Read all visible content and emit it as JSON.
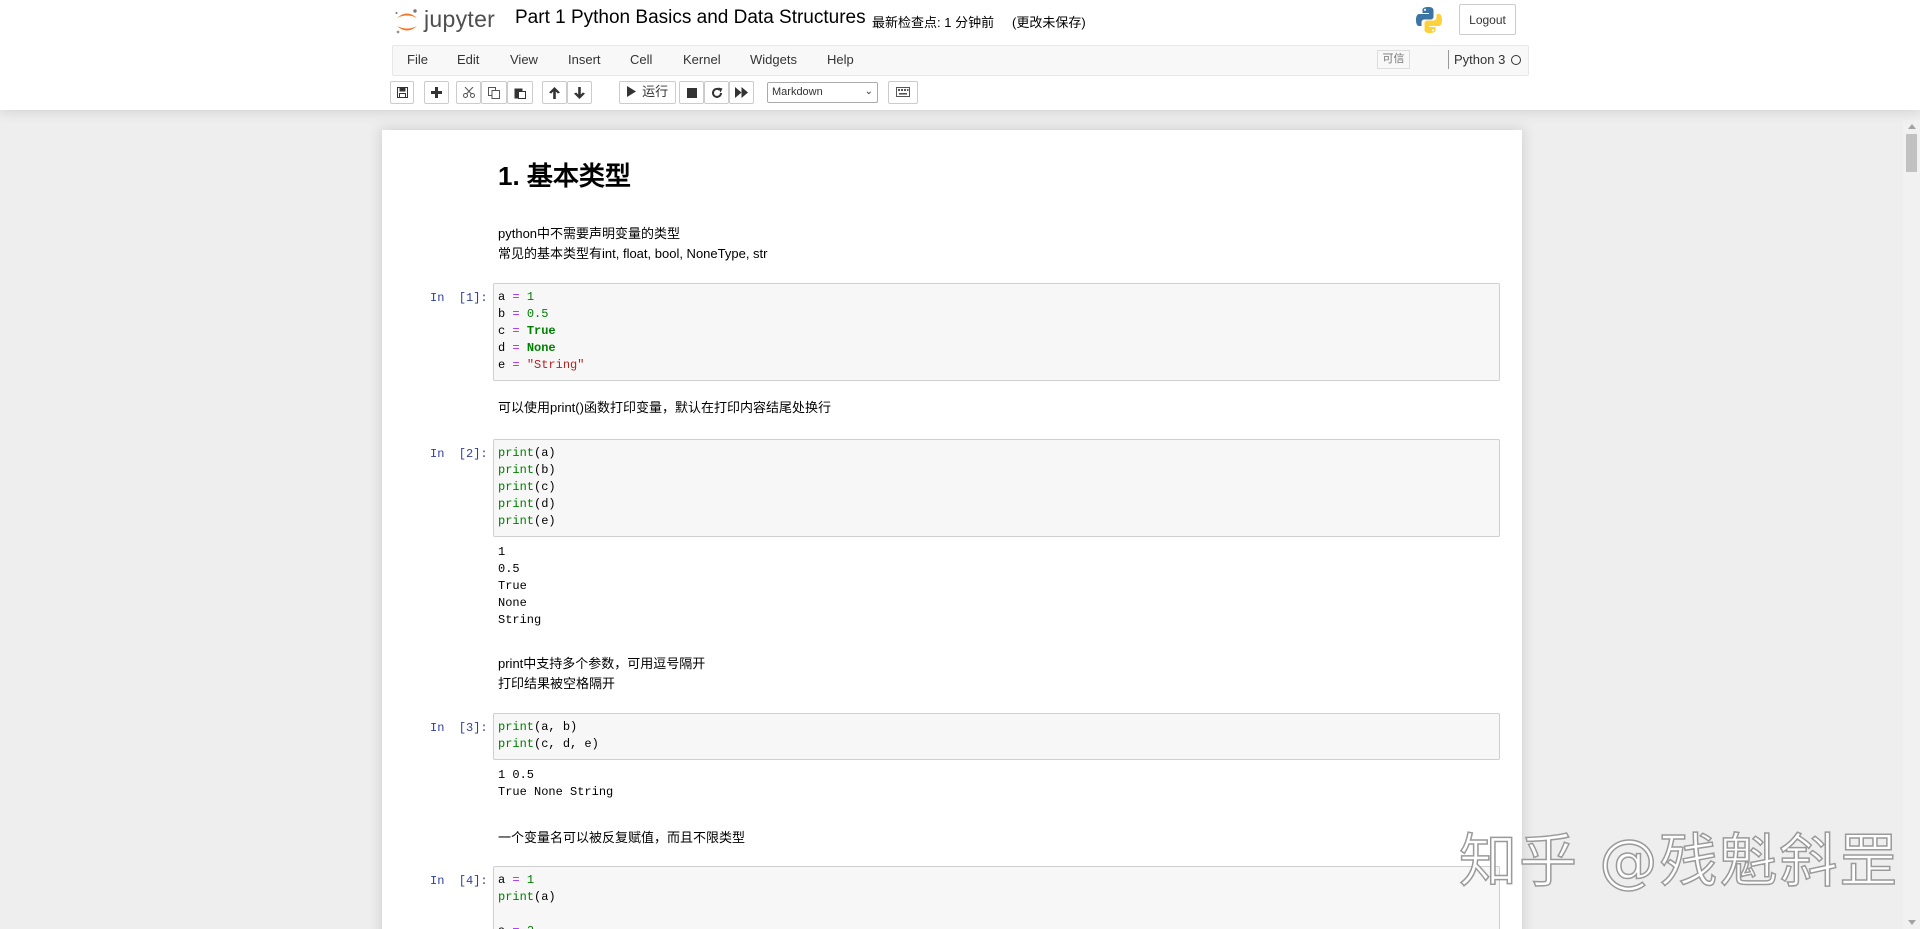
{
  "header": {
    "logo_text": "jupyter",
    "notebook_title": "Part 1 Python Basics and Data Structures",
    "checkpoint": "最新检查点: 1 分钟前",
    "autosave_status": "(更改未保存)",
    "logout_label": "Logout"
  },
  "menubar": {
    "items": [
      "File",
      "Edit",
      "View",
      "Insert",
      "Cell",
      "Kernel",
      "Widgets",
      "Help"
    ],
    "trusted_label": "可信",
    "kernel_name": "Python 3"
  },
  "toolbar": {
    "run_label": "运行",
    "cell_type": "Markdown",
    "buttons": [
      "save-icon",
      "plus-icon",
      "cut-icon",
      "copy-icon",
      "paste-icon",
      "arrow-up-icon",
      "arrow-down-icon",
      "run-icon",
      "stop-icon",
      "restart-icon",
      "fast-forward-icon",
      "keyboard-icon"
    ]
  },
  "cells": {
    "heading": "1. 基本类型",
    "md1_line1": "python中不需要声明变量的类型",
    "md1_line2": "常见的基本类型有int, float, bool, NoneType, str",
    "prompt1": "In  [1]:",
    "prompt2": "In  [2]:",
    "output2": "1\n0.5\nTrue\nNone\nString",
    "md2": "可以使用print()函数打印变量，默认在打印内容结尾处换行",
    "md3_line1": "print中支持多个参数，可用逗号隔开",
    "md3_line2": "打印结果被空格隔开",
    "prompt3": "In  [3]:",
    "output3": "1 0.5\nTrue None String",
    "md4": "一个变量名可以被反复赋值，而且不限类型",
    "prompt4": "In  [4]:"
  },
  "watermark": "知乎 @残魁斜罡"
}
